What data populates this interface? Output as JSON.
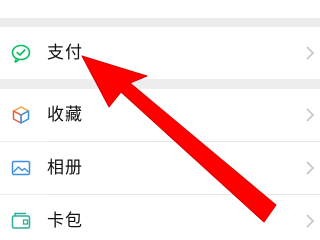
{
  "menu": {
    "items": [
      {
        "label": "支付",
        "icon": "wechat-pay-icon"
      },
      {
        "label": "收藏",
        "icon": "favorites-cube-icon"
      },
      {
        "label": "相册",
        "icon": "album-picture-icon"
      },
      {
        "label": "卡包",
        "icon": "card-wallet-icon"
      }
    ]
  },
  "colors": {
    "pay_green": "#07c160",
    "arrow_red": "#ff0000",
    "background": "#ededed"
  }
}
